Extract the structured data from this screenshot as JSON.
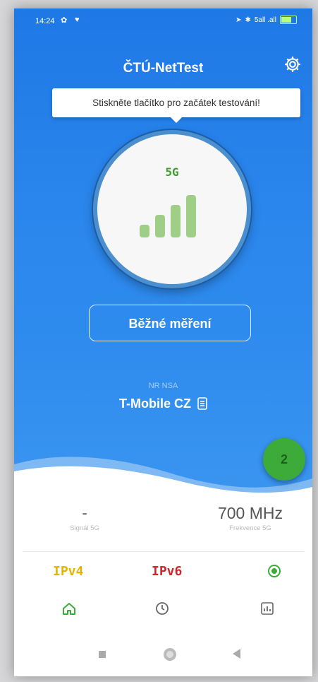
{
  "status_bar": {
    "time": "14:24",
    "left_icons": [
      "settings-gear-icon",
      "heart-icon"
    ],
    "right_icons": [
      "location-arrow-icon",
      "bluetooth-icon",
      "signal-icon",
      "signal-icon",
      "battery-icon"
    ],
    "signal_text": "5all .all"
  },
  "header": {
    "title": "ČTÚ-NetTest",
    "settings_icon": "gear-icon"
  },
  "tooltip": {
    "text": "Stiskněte tlačítko pro začátek testování!"
  },
  "dial": {
    "network_label": "5G",
    "signal_bars_filled": 4,
    "signal_bars_total": 4
  },
  "start_button": {
    "label": "Běžné měření"
  },
  "network": {
    "type": "NR NSA",
    "operator": "T-Mobile CZ",
    "sim_icon": "sim-card-icon"
  },
  "fab": {
    "icon": "sim-swap-icon",
    "label": "2"
  },
  "info": {
    "signal_value": "-",
    "signal_label": "Signál 5G",
    "frequency_value": "700 MHz",
    "frequency_label": "Frekvence 5G"
  },
  "protocols": {
    "ipv4": "IPv4",
    "ipv6": "IPv6",
    "location_icon": "location-target-icon"
  },
  "bottom_nav": [
    {
      "name": "home-icon"
    },
    {
      "name": "history-icon"
    },
    {
      "name": "stats-icon"
    }
  ],
  "colors": {
    "primary_blue": "#2a86ec",
    "accent_green": "#3cab3a",
    "ipv4_color": "#e6b400",
    "ipv6_color": "#d12626",
    "bar_green": "#9fcf86"
  }
}
